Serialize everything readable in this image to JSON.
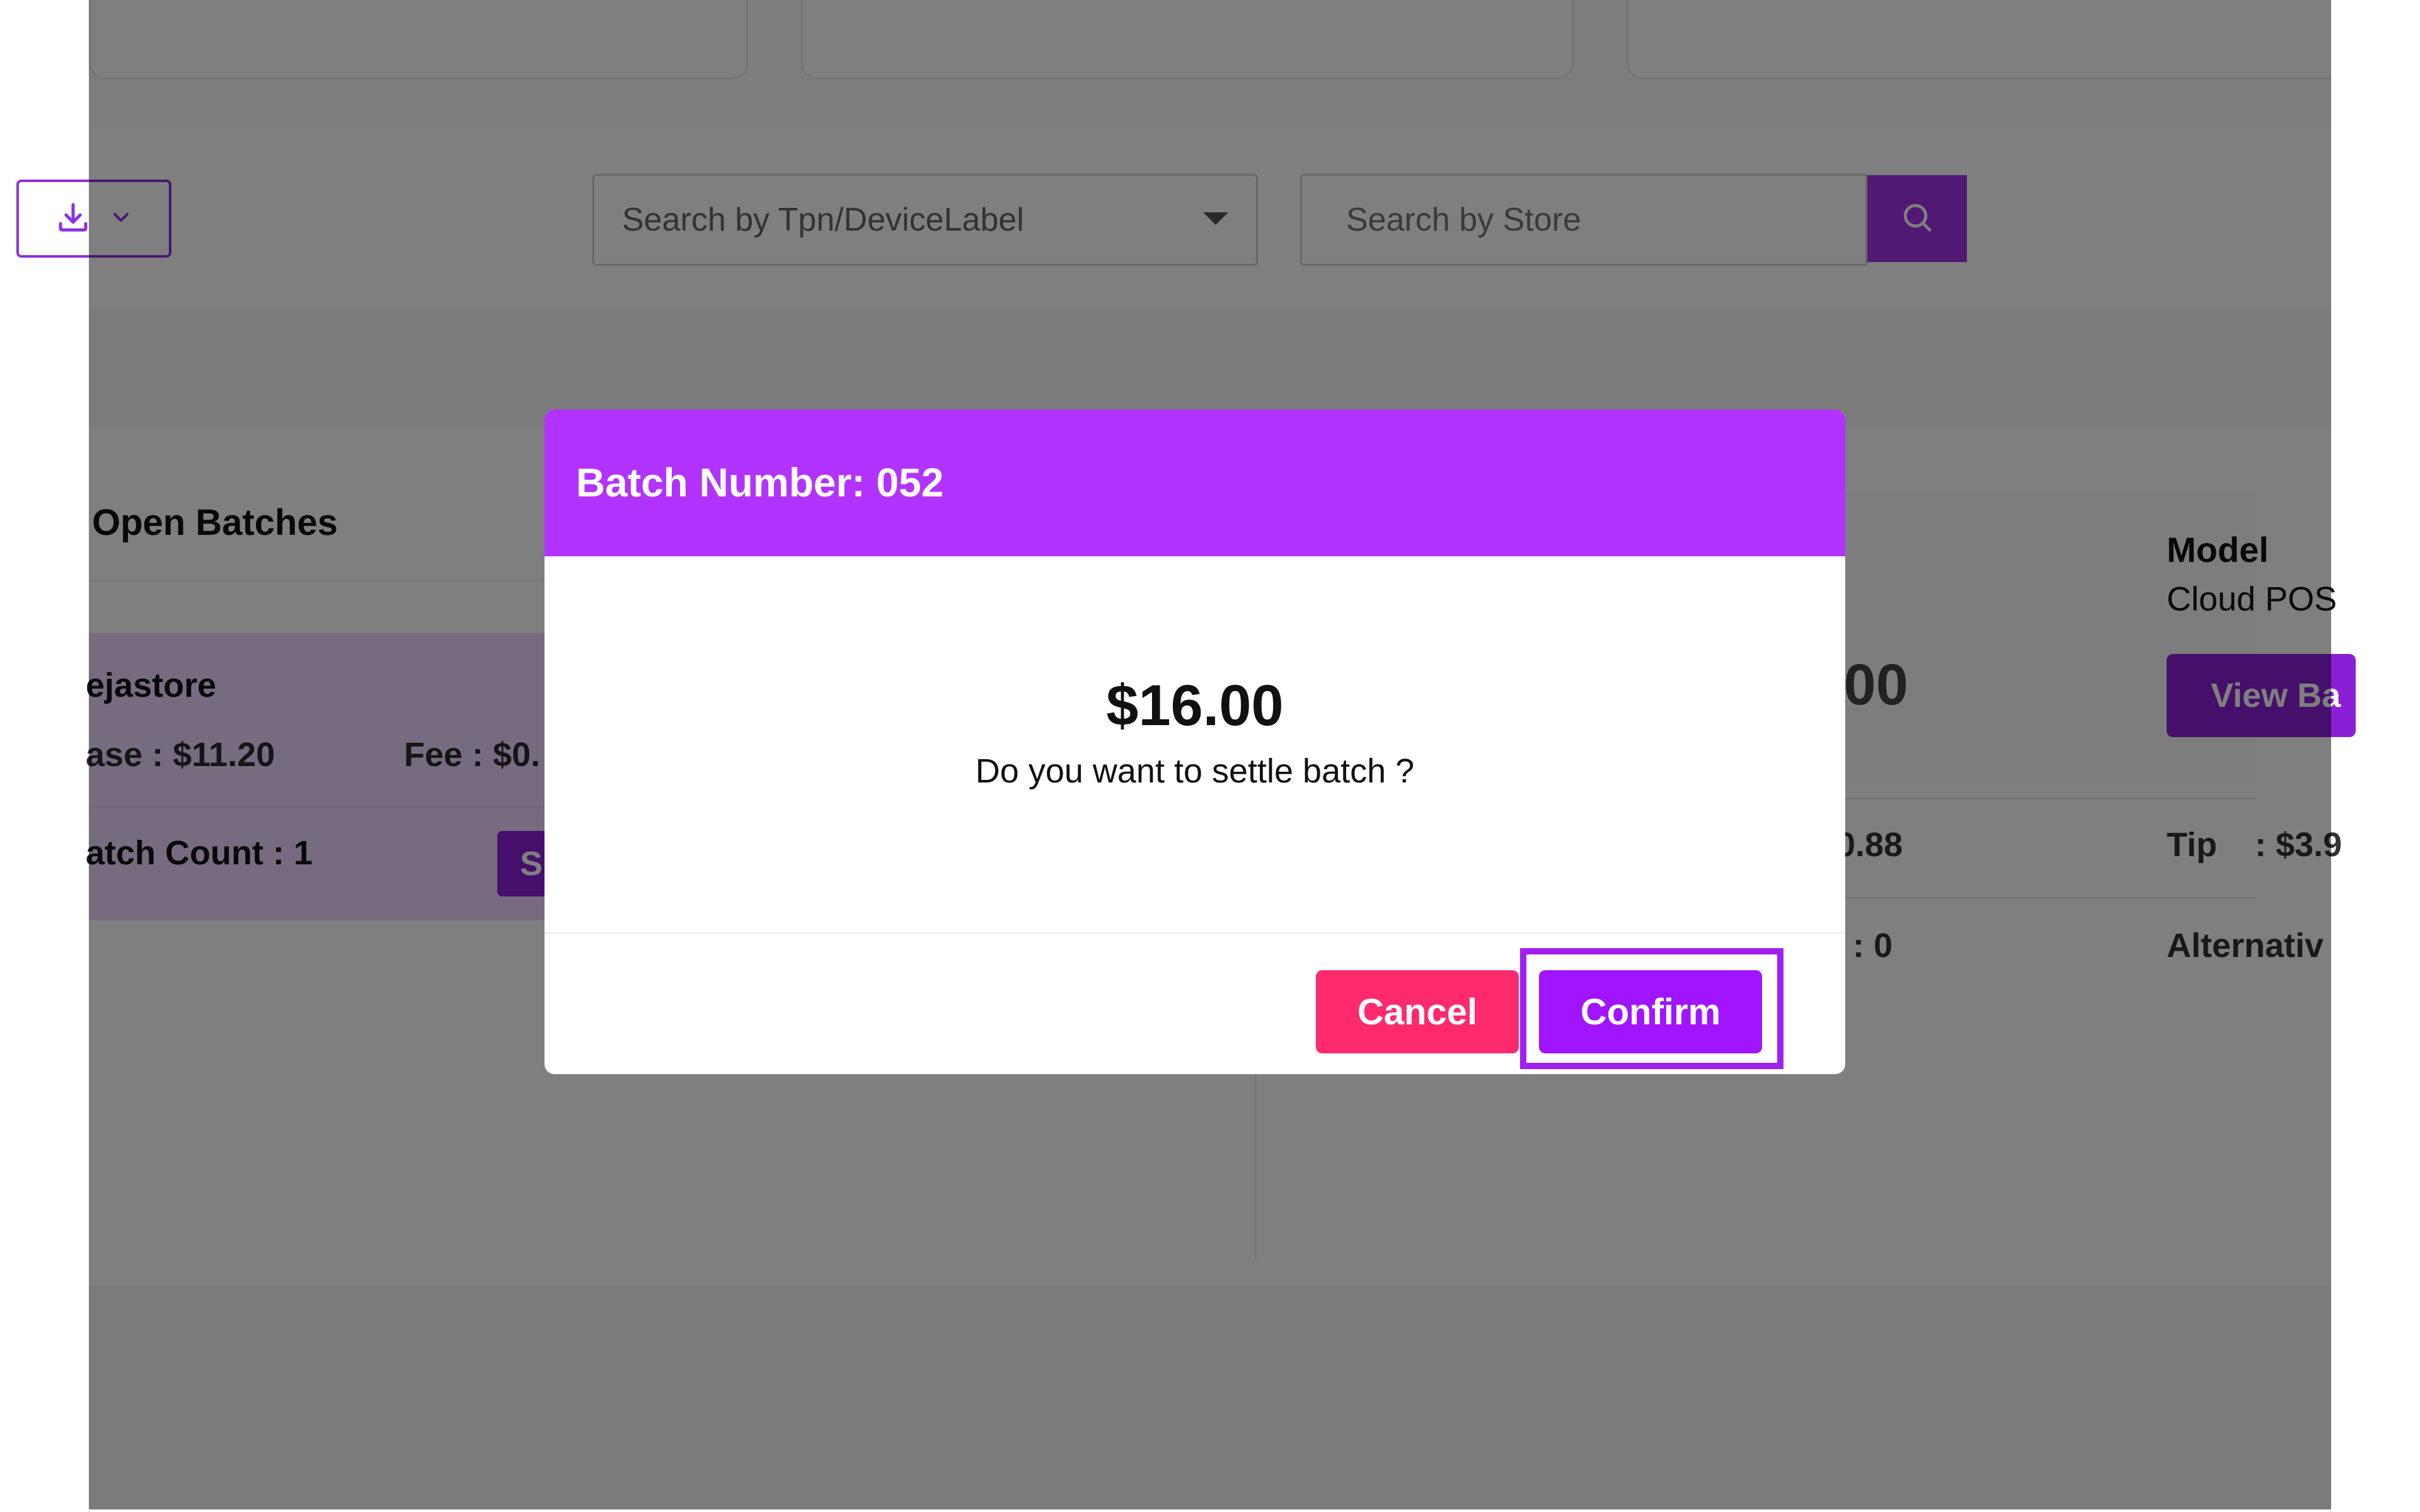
{
  "toolbar": {
    "download_icon": "download-icon",
    "chevron_icon": "chevron-down-icon",
    "device_select_placeholder": "Search by Tpn/DeviceLabel",
    "store_search_placeholder": "Search by Store",
    "search_icon": "search-icon"
  },
  "open_batches": {
    "heading": "Open Batches",
    "card": {
      "store": "ejastore",
      "base": "ase : $11.20",
      "fee": "Fee : $0.",
      "batch_count": "atch Count : 1",
      "settle_label": "S"
    }
  },
  "batch_detail": {
    "amount": ".00",
    "model_label": "Model",
    "model_value": "Cloud POS",
    "view_button": "View Ba",
    "tax_value": "0.88",
    "tip": "Tip    : $3.9",
    "count_value": ": 0",
    "alternative": "Alternativ"
  },
  "modal": {
    "title": "Batch Number: 052",
    "amount": "$16.00",
    "question": "Do you want to settle batch ?",
    "cancel_label": "Cancel",
    "confirm_label": "Confirm"
  },
  "colors": {
    "header": "#b233ff",
    "confirm": "#a014ff",
    "cancel": "#ff2a6e",
    "accent": "#8a1fd6"
  }
}
